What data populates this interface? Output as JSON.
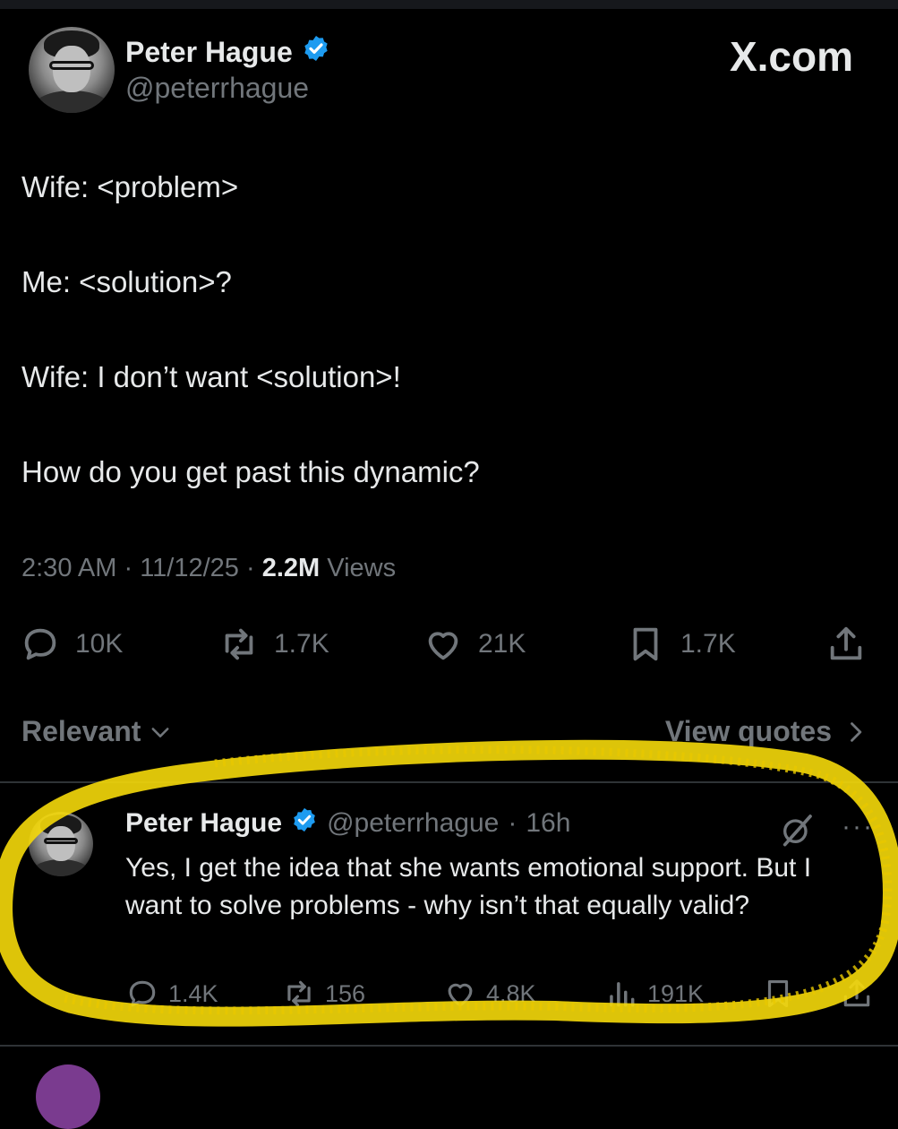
{
  "post": {
    "author": {
      "name": "Peter Hague",
      "handle": "@peterrhague",
      "verified": true
    },
    "brand": "X.com",
    "lines": [
      "Wife: <problem>",
      "Me: <solution>?",
      "Wife: I don’t want <solution>!",
      "How do you get past this dynamic?"
    ],
    "time": "2:30 AM",
    "date": "11/12/25",
    "views_count": "2.2M",
    "views_label": "Views",
    "stats": {
      "replies": "10K",
      "reposts": "1.7K",
      "likes": "21K",
      "bookmarks": "1.7K"
    }
  },
  "controls": {
    "sort_label": "Relevant",
    "quotes_label": "View quotes"
  },
  "reply": {
    "author": {
      "name": "Peter Hague",
      "handle": "@peterrhague",
      "verified": true
    },
    "age": "16h",
    "text": "Yes, I get the idea that she wants emotional support. But I want to solve problems - why isn’t that equally valid?",
    "stats": {
      "replies": "1.4K",
      "reposts": "156",
      "likes": "4.8K",
      "views": "191K"
    }
  },
  "colors": {
    "background": "#000000",
    "text": "#e7e9ea",
    "muted": "#71767b",
    "verified": "#1d9bf0",
    "highlight": "#f5d90a"
  },
  "icons": [
    "reply-icon",
    "repost-icon",
    "like-icon",
    "bookmark-icon",
    "share-icon",
    "views-icon",
    "grok-icon",
    "more-icon",
    "verified-badge-icon",
    "chevron-down-icon",
    "chevron-right-icon"
  ]
}
